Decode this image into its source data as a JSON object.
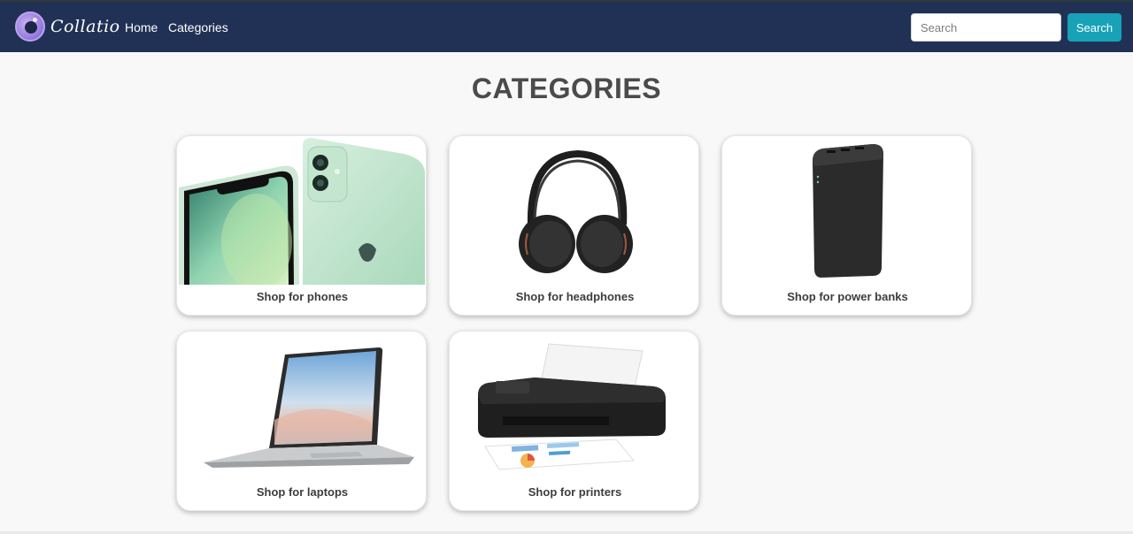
{
  "navbar": {
    "brand": "Collatio",
    "links": [
      "Home",
      "Categories"
    ],
    "search_placeholder": "Search",
    "search_button": "Search"
  },
  "page": {
    "title": "CATEGORIES"
  },
  "categories": [
    {
      "label": "Shop for phones",
      "icon": "phone-image"
    },
    {
      "label": "Shop for headphones",
      "icon": "headphones-image"
    },
    {
      "label": "Shop for power banks",
      "icon": "power-bank-image"
    },
    {
      "label": "Shop for laptops",
      "icon": "laptop-image"
    },
    {
      "label": "Shop for printers",
      "icon": "printer-image"
    }
  ],
  "colors": {
    "navbar": "#213155",
    "search_button": "#17a2b8",
    "title": "#4b4b4b"
  }
}
